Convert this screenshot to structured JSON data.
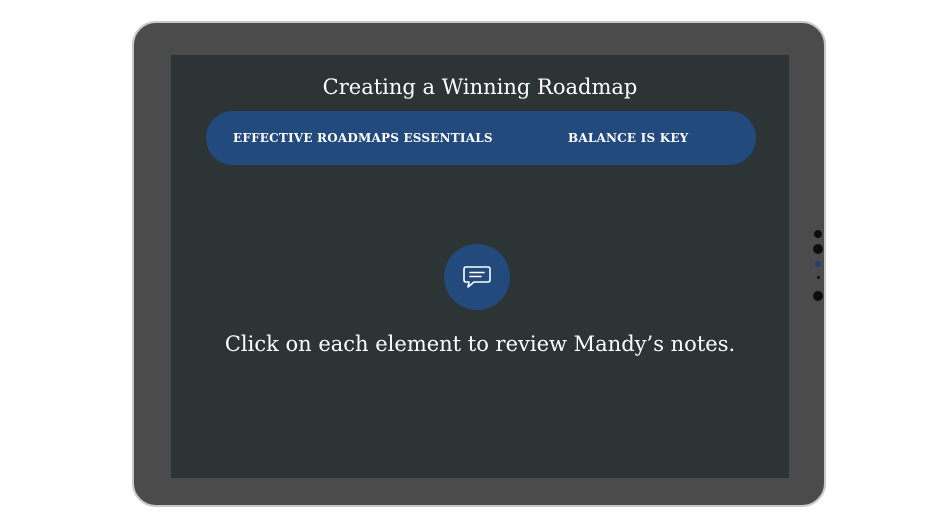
{
  "slide": {
    "title": "Creating a Winning Roadmap",
    "tabs": [
      {
        "label": "EFFECTIVE ROADMAPS ESSENTIALS"
      },
      {
        "label": "BALANCE IS KEY"
      }
    ],
    "notes_icon": "speech-bubble-icon",
    "instruction": "Click on each element to review Mandy’s notes."
  },
  "colors": {
    "frame": "#4b4b4b",
    "screen_background": "#2d3436",
    "accent": "#224a7c",
    "text": "#ffffff"
  }
}
